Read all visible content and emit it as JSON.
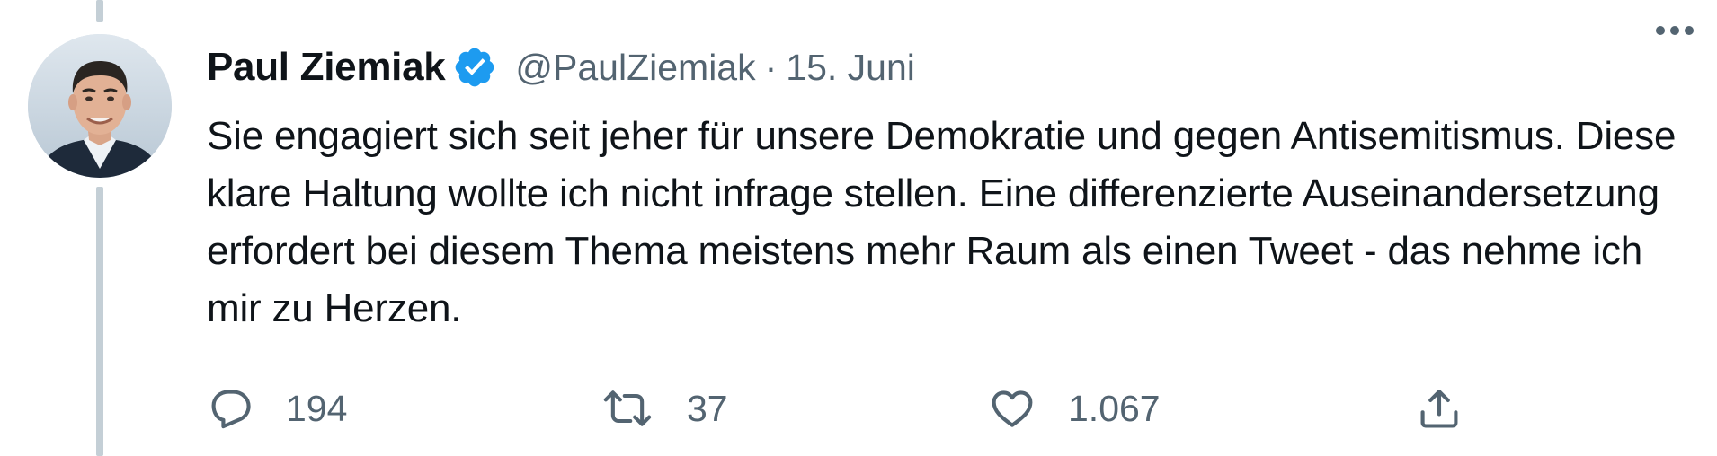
{
  "tweet": {
    "author": {
      "name": "Paul Ziemiak",
      "handle": "@PaulZiemiak",
      "verified": true
    },
    "separator": "·",
    "date": "15. Juni",
    "text": "Sie engagiert sich seit jeher für unsere Demokratie und gegen Antisemitismus. Diese klare Haltung wollte ich nicht infrage stellen. Eine differenzierte Auseinandersetzung erfordert bei diesem Thema meistens mehr Raum als einen Tweet - das nehme ich mir zu Herzen.",
    "stats": {
      "replies": "194",
      "retweets": "37",
      "likes": "1.067"
    }
  },
  "icons": {
    "verified": "verified-badge-icon",
    "more": "more-dots-icon",
    "reply": "reply-bubble-icon",
    "retweet": "retweet-arrows-icon",
    "like": "heart-icon",
    "share": "share-upload-icon"
  },
  "colors": {
    "text_primary": "#0f1419",
    "text_secondary": "#536471",
    "verified_blue": "#1d9bf0",
    "thread_line": "#c4cfd6"
  }
}
